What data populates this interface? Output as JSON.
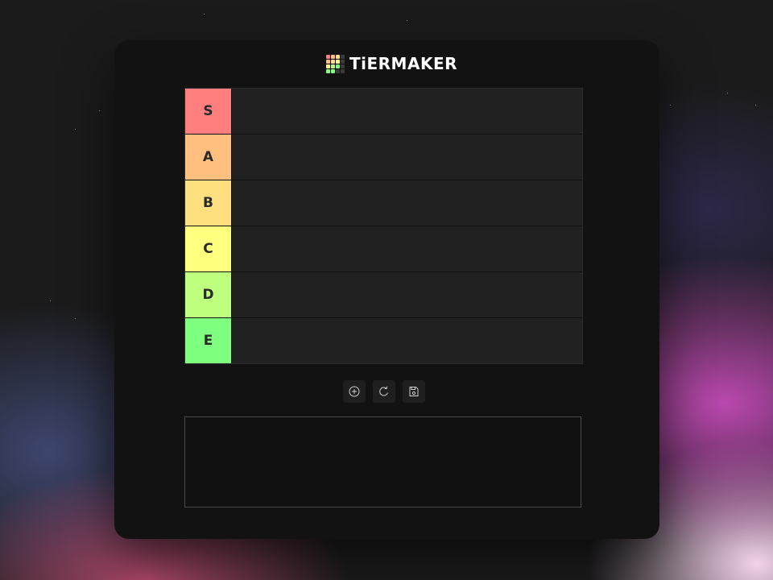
{
  "app": {
    "logo_text": "TiERMAKER",
    "logo_colors": [
      "#ff7f7f",
      "#ffbf7f",
      "#ffdf7f",
      "#3a3a3a",
      "#ffbf7f",
      "#ffdf7f",
      "#ffff7f",
      "#3a3a3a",
      "#ffff7f",
      "#bfff7f",
      "#7fff7f",
      "#3a3a3a",
      "#7fff7f",
      "#7fff7f",
      "#3a3a3a",
      "#3a3a3a"
    ]
  },
  "tiers": [
    {
      "label": "S",
      "color": "#ff7f7f"
    },
    {
      "label": "A",
      "color": "#ffbf7f"
    },
    {
      "label": "B",
      "color": "#ffdf7f"
    },
    {
      "label": "C",
      "color": "#ffff7f"
    },
    {
      "label": "D",
      "color": "#bfff7f"
    },
    {
      "label": "E",
      "color": "#7fff7f"
    }
  ],
  "toolbar": {
    "buttons": [
      {
        "name": "add-button",
        "icon": "plus-circle-icon"
      },
      {
        "name": "reset-button",
        "icon": "refresh-icon"
      },
      {
        "name": "save-button",
        "icon": "save-icon"
      }
    ]
  },
  "theme": {
    "card_bg": "#121212",
    "row_bg": "#212121"
  }
}
